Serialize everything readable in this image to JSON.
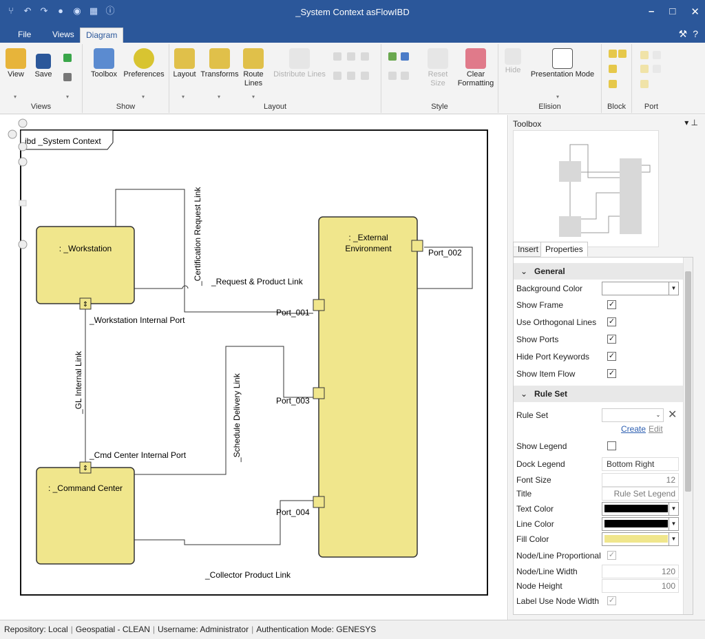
{
  "window": {
    "title": "_System Context asFlowIBD"
  },
  "menu_tabs": [
    {
      "label": "File"
    },
    {
      "label": "Views"
    },
    {
      "label": "Diagram"
    }
  ],
  "ribbon": {
    "views": {
      "label": "Views",
      "buttons": [
        "View",
        "Save"
      ]
    },
    "show": {
      "label": "Show",
      "buttons": [
        "Toolbox",
        "Preferences"
      ]
    },
    "layout": {
      "label": "Layout",
      "buttons": [
        "Layout",
        "Transforms",
        "Route Lines",
        "Distribute Lines"
      ]
    },
    "style": {
      "label": "Style",
      "buttons": [
        "Reset Size",
        "Clear Formatting"
      ]
    },
    "elision": {
      "label": "Elision",
      "buttons": [
        "Hide",
        "Presentation Mode"
      ]
    },
    "block": {
      "label": "Block"
    },
    "port": {
      "label": "Port"
    }
  },
  "diagram": {
    "frame_title": "ibd _System Context",
    "blocks": {
      "workstation": ": _Workstation",
      "command_center": ": _Command Center",
      "external_line1": ": _External",
      "external_line2": "Environment"
    },
    "ports": {
      "workstation_internal": "_Workstation Internal Port",
      "cmd_center_internal": "_Cmd Center Internal Port",
      "port_001": "Port_001",
      "port_002": "Port_002",
      "port_003": "Port_003",
      "port_004": "Port_004"
    },
    "links": {
      "certification": "_Certification Request Link",
      "request_product": "_Request & Product Link",
      "gl_internal": "_GL Internal Link",
      "schedule_delivery": "_Schedule Delivery Link",
      "collector_product": "_Collector Product Link"
    },
    "colors": {
      "block_fill": "#f0e68c",
      "block_stroke": "#333333"
    }
  },
  "panel": {
    "toolbox_title": "Toolbox",
    "tabs": [
      "Insert",
      "Properties"
    ],
    "general": {
      "header": "General",
      "background_color": "Background Color",
      "show_frame": "Show Frame",
      "use_orthogonal": "Use Orthogonal Lines",
      "show_ports": "Show Ports",
      "hide_port_keywords": "Hide Port Keywords",
      "show_item_flow": "Show Item Flow"
    },
    "rule_set": {
      "header": "Rule Set",
      "rule_set": "Rule Set",
      "create": "Create",
      "edit": "Edit",
      "show_legend": "Show Legend",
      "dock_legend": "Dock Legend",
      "dock_legend_value": "Bottom Right",
      "font_size": "Font Size",
      "font_size_value": "12",
      "title": "Title",
      "title_value": "Rule Set Legend",
      "text_color": "Text Color",
      "line_color": "Line Color",
      "fill_color": "Fill Color",
      "node_line_proportional": "Node/Line Proportional",
      "node_line_width": "Node/Line Width",
      "node_line_width_value": "120",
      "node_height": "Node Height",
      "node_height_value": "100",
      "label_use_node_width": "Label Use Node Width"
    }
  },
  "status": {
    "repository": "Repository: Local",
    "project": "Geospatial - CLEAN",
    "username": "Username: Administrator",
    "auth": "Authentication Mode: GENESYS"
  }
}
